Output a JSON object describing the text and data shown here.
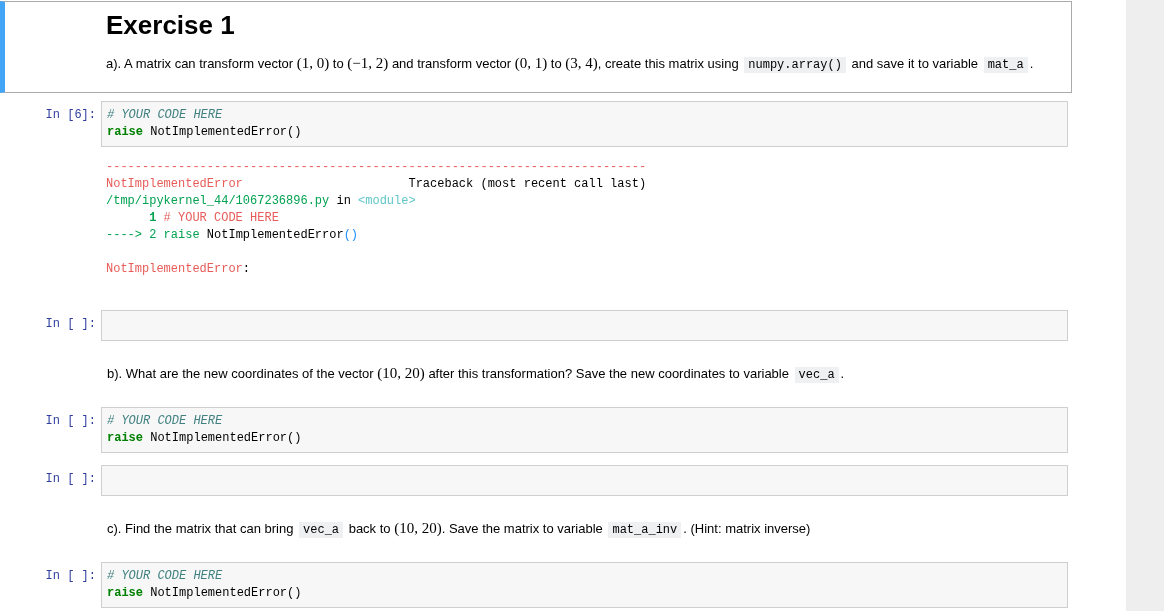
{
  "cells": [
    {
      "kind": "markdown",
      "selected": true,
      "heading": "Exercise 1",
      "paragraph": [
        {
          "kind": "text",
          "text": "a). A matrix can transform vector "
        },
        {
          "kind": "math",
          "text": "(1, 0)"
        },
        {
          "kind": "text",
          "text": " to "
        },
        {
          "kind": "math",
          "text": "(−1, 2)"
        },
        {
          "kind": "text",
          "text": " and transform vector "
        },
        {
          "kind": "math",
          "text": "(0, 1)"
        },
        {
          "kind": "text",
          "text": " to "
        },
        {
          "kind": "math",
          "text": "(3, 4)"
        },
        {
          "kind": "text",
          "text": ", create this matrix using "
        },
        {
          "kind": "code",
          "text": "numpy.array()"
        },
        {
          "kind": "text",
          "text": " and save it to variable "
        },
        {
          "kind": "code",
          "text": "mat_a"
        },
        {
          "kind": "text",
          "text": "."
        }
      ]
    },
    {
      "kind": "code",
      "selected": false,
      "prompt": "In [6]:",
      "lines": [
        [
          {
            "kind": "comment",
            "text": "# YOUR CODE HERE"
          }
        ],
        [
          {
            "kind": "keyword",
            "text": "raise"
          },
          {
            "kind": "plain",
            "text": " NotImplementedError()"
          }
        ]
      ],
      "output": {
        "traceback": [
          [
            {
              "kind": "rule",
              "text": "---------------------------------------------------------------------------"
            }
          ],
          [
            {
              "kind": "ename",
              "text": "NotImplementedError"
            },
            {
              "kind": "plain",
              "text": "                       Traceback (most recent call last)"
            }
          ],
          [
            {
              "kind": "path",
              "text": "/tmp/ipykernel_44/1067236896.py"
            },
            {
              "kind": "plain",
              "text": " in "
            },
            {
              "kind": "module",
              "text": "<module>"
            }
          ],
          [
            {
              "kind": "lineno",
              "text": "      1 "
            },
            {
              "kind": "ename",
              "text": "# YOUR CODE HERE"
            }
          ],
          [
            {
              "kind": "path",
              "text": "----> 2 raise"
            },
            {
              "kind": "plain",
              "text": " NotImplementedError"
            },
            {
              "kind": "paren",
              "text": "()"
            }
          ]
        ],
        "error": [
          [
            {
              "kind": "ename",
              "text": "NotImplementedError"
            },
            {
              "kind": "plain",
              "text": ":"
            }
          ]
        ]
      }
    },
    {
      "kind": "code",
      "selected": false,
      "prompt": "In [ ]:"
    },
    {
      "kind": "markdown",
      "selected": false,
      "paragraph": [
        {
          "kind": "text",
          "text": "b). What are the new coordinates of the vector "
        },
        {
          "kind": "math",
          "text": "(10, 20)"
        },
        {
          "kind": "text",
          "text": " after this transformation? Save the new coordinates to variable "
        },
        {
          "kind": "code",
          "text": "vec_a"
        },
        {
          "kind": "text",
          "text": "."
        }
      ]
    },
    {
      "kind": "code",
      "selected": false,
      "prompt": "In [ ]:",
      "lines": [
        [
          {
            "kind": "comment",
            "text": "# YOUR CODE HERE"
          }
        ],
        [
          {
            "kind": "keyword",
            "text": "raise"
          },
          {
            "kind": "plain",
            "text": " NotImplementedError()"
          }
        ]
      ]
    },
    {
      "kind": "code",
      "selected": false,
      "prompt": "In [ ]:"
    },
    {
      "kind": "markdown",
      "selected": false,
      "paragraph": [
        {
          "kind": "text",
          "text": "c). Find the matrix that can bring "
        },
        {
          "kind": "code",
          "text": "vec_a"
        },
        {
          "kind": "text",
          "text": " back to "
        },
        {
          "kind": "math",
          "text": "(10, 20)"
        },
        {
          "kind": "text",
          "text": ". Save the matrix to variable "
        },
        {
          "kind": "code",
          "text": "mat_a_inv"
        },
        {
          "kind": "text",
          "text": ". (Hint: matrix inverse)"
        }
      ]
    },
    {
      "kind": "code",
      "selected": false,
      "prompt": "In [ ]:",
      "lines": [
        [
          {
            "kind": "comment",
            "text": "# YOUR CODE HERE"
          }
        ],
        [
          {
            "kind": "keyword",
            "text": "raise"
          },
          {
            "kind": "plain",
            "text": " NotImplementedError()"
          }
        ]
      ]
    }
  ]
}
